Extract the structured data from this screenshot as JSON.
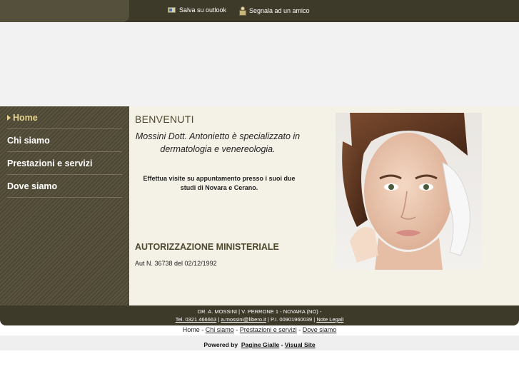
{
  "topbar": {
    "outlook_label": "Salva su outlook",
    "friend_label": "Segnala ad un amico"
  },
  "nav": {
    "items": [
      {
        "label": "Home",
        "active": true
      },
      {
        "label": "Chi siamo"
      },
      {
        "label": "Prestazioni e servizi"
      },
      {
        "label": "Dove siamo"
      }
    ]
  },
  "main": {
    "welcome": "BENVENUTI",
    "intro": "Mossini Dott. Antonietto è specializzato in dermatologia e venereologia.",
    "visits": "Effettua visite su appuntamento presso i suoi due studi di Novara e Cerano.",
    "auth_title": "AUTORIZZAZIONE MINISTERIALE",
    "auth_text": "Aut N. 36738 del 02/12/1992"
  },
  "footer": {
    "address": "DR. A. MOSSINI | V. PERRONE 1 - NOVARA (NO) -",
    "phone": "Tel. 0321 466663",
    "sep1": " | ",
    "email": "a.mossini@libero.it",
    "vat": " | P.I. 00901960039 | ",
    "legal": "Note Legali"
  },
  "bottomnav": {
    "home": "Home",
    "dash": " - ",
    "chi_siamo": "Chi siamo",
    "prestazioni": "Prestazioni e servizi",
    "dove_siamo": "Dove siamo"
  },
  "powered": {
    "prefix": "Powered by",
    "pagine_gialle": "Pagine Gialle",
    "dash": " - ",
    "visual_site": "Visual Site"
  },
  "colors": {
    "topbar": "#3e3a2a",
    "sidebar": "#55503c",
    "content_bg": "#f4f1e6",
    "active_nav": "#e6d28e"
  }
}
